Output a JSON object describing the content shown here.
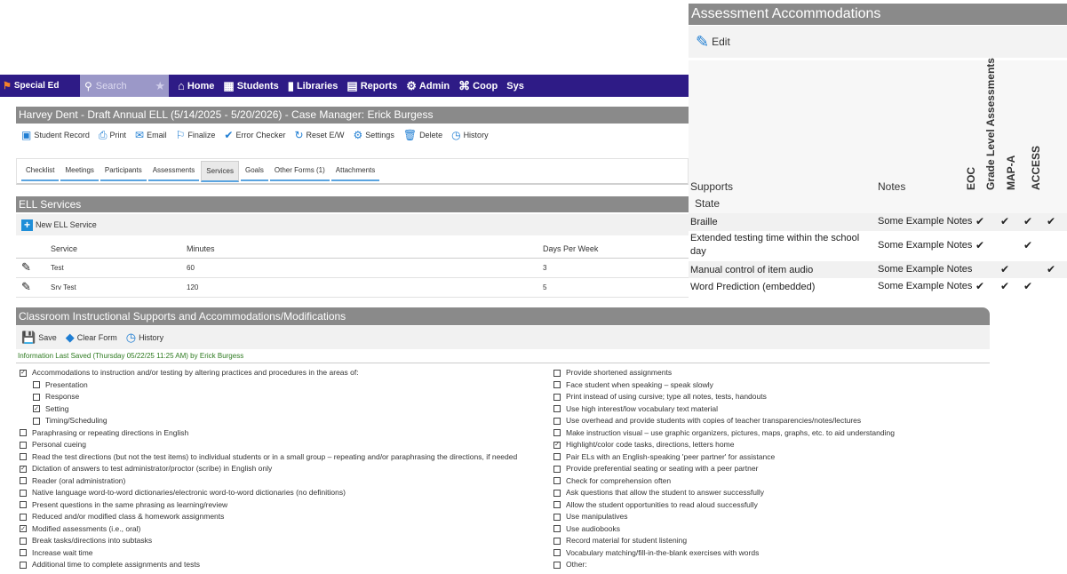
{
  "nav": {
    "brand": "Special Ed",
    "search_placeholder": "Search",
    "items": [
      "Home",
      "Students",
      "Libraries",
      "Reports",
      "Admin",
      "Coop",
      "Sys"
    ]
  },
  "record": {
    "title": "Harvey Dent - Draft Annual ELL (5/14/2025 - 5/20/2026) - Case Manager: Erick Burgess",
    "toolbar": [
      "Student Record",
      "Print",
      "Email",
      "Finalize",
      "Error Checker",
      "Reset E/W",
      "Settings",
      "Delete",
      "History"
    ],
    "tabs": [
      "Checklist",
      "Meetings",
      "Participants",
      "Assessments",
      "Services",
      "Goals",
      "Other Forms (1)",
      "Attachments"
    ],
    "active_tab": "Services"
  },
  "ell_services": {
    "title": "ELL Services",
    "new_button": "New ELL Service",
    "columns": [
      "Service",
      "Minutes",
      "Days Per Week"
    ],
    "rows": [
      {
        "service": "Test",
        "minutes": "60",
        "days": "3"
      },
      {
        "service": "Srv Test",
        "minutes": "120",
        "days": "5"
      }
    ]
  },
  "classroom": {
    "title": "Classroom Instructional Supports and Accommodations/Modifications",
    "save_label": "Save",
    "clear_label": "Clear Form",
    "history_label": "History",
    "saved_text": "Information Last Saved (Thursday 05/22/25 11:25 AM) by Erick Burgess",
    "left_items": [
      {
        "text": "Accommodations to instruction and/or testing by altering practices and procedures in the areas of:",
        "checked": true,
        "sub": false
      },
      {
        "text": "Presentation",
        "checked": false,
        "sub": true
      },
      {
        "text": "Response",
        "checked": false,
        "sub": true
      },
      {
        "text": "Setting",
        "checked": true,
        "sub": true
      },
      {
        "text": "Timing/Scheduling",
        "checked": false,
        "sub": true
      },
      {
        "text": "Paraphrasing or repeating directions in English",
        "checked": false,
        "sub": false
      },
      {
        "text": "Personal cueing",
        "checked": false,
        "sub": false
      },
      {
        "text": "Read the test directions (but not the test items) to individual students or in a small group – repeating and/or paraphrasing the directions, if needed",
        "checked": false,
        "sub": false
      },
      {
        "text": "Dictation of answers to test administrator/proctor (scribe) in English only",
        "checked": true,
        "sub": false
      },
      {
        "text": "Reader (oral administration)",
        "checked": false,
        "sub": false
      },
      {
        "text": "Native language word-to-word dictionaries/electronic word-to-word dictionaries (no definitions)",
        "checked": false,
        "sub": false
      },
      {
        "text": "Present questions in the same phrasing as learning/review",
        "checked": false,
        "sub": false
      },
      {
        "text": "Reduced and/or modified class & homework assignments",
        "checked": false,
        "sub": false
      },
      {
        "text": "Modified assessments (i.e., oral)",
        "checked": true,
        "sub": false
      },
      {
        "text": "Break tasks/directions into subtasks",
        "checked": false,
        "sub": false
      },
      {
        "text": "Increase wait time",
        "checked": false,
        "sub": false
      },
      {
        "text": "Additional time to complete assignments and tests",
        "checked": false,
        "sub": false
      }
    ],
    "right_items": [
      {
        "text": "Provide shortened assignments",
        "checked": false
      },
      {
        "text": "Face student when speaking – speak slowly",
        "checked": false
      },
      {
        "text": "Print instead of using cursive; type all notes, tests, handouts",
        "checked": false
      },
      {
        "text": "Use high interest/low vocabulary text material",
        "checked": false
      },
      {
        "text": "Use overhead and provide students with copies of teacher transparencies/notes/lectures",
        "checked": false
      },
      {
        "text": "Make instruction visual – use graphic organizers, pictures, maps, graphs, etc. to aid understanding",
        "checked": false
      },
      {
        "text": "Highlight/color code tasks, directions, letters home",
        "checked": true
      },
      {
        "text": "Pair ELs with an English-speaking 'peer partner' for assistance",
        "checked": false
      },
      {
        "text": "Provide preferential seating or seating with a peer partner",
        "checked": false
      },
      {
        "text": "Check for comprehension often",
        "checked": false
      },
      {
        "text": "Ask questions that allow the student to answer successfully",
        "checked": false
      },
      {
        "text": "Allow the student opportunities to read aloud successfully",
        "checked": false
      },
      {
        "text": "Use manipulatives",
        "checked": false
      },
      {
        "text": "Use audiobooks",
        "checked": false
      },
      {
        "text": "Record material for student listening",
        "checked": false
      },
      {
        "text": "Vocabulary matching/fill-in-the-blank exercises with words",
        "checked": false
      },
      {
        "text": "Other:",
        "checked": false
      }
    ]
  },
  "assessment": {
    "title": "Assessment Accommodations",
    "edit_label": "Edit",
    "supports_label": "Supports",
    "notes_label": "Notes",
    "state_label": "State",
    "columns": [
      "EOC",
      "Grade Level Assessments",
      "MAP-A",
      "ACCESS"
    ],
    "rows": [
      {
        "support": "Braille",
        "notes": "Some Example Notes",
        "marks": [
          true,
          true,
          true,
          true
        ]
      },
      {
        "support": "Extended testing time within the school day",
        "notes": "Some Example Notes",
        "marks": [
          true,
          false,
          true,
          false
        ]
      },
      {
        "support": "Manual control of item audio",
        "notes": "Some Example Notes",
        "marks": [
          false,
          true,
          false,
          true
        ]
      },
      {
        "support": "Word Prediction (embedded)",
        "notes": "Some Example Notes",
        "marks": [
          true,
          true,
          true,
          false
        ]
      }
    ],
    "checkmark": "✔"
  }
}
